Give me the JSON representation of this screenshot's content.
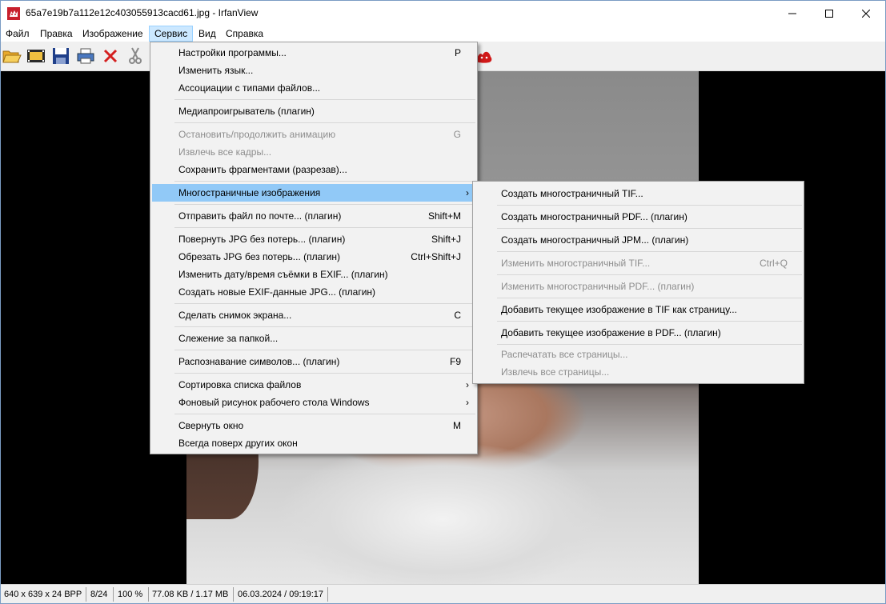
{
  "window": {
    "title": "65a7e19b7a112e12c403055913cacd61.jpg - IrfanView",
    "icon": "irfanview-cat-icon"
  },
  "menubar": [
    {
      "label": "Файл"
    },
    {
      "label": "Правка"
    },
    {
      "label": "Изображение"
    },
    {
      "label": "Сервис",
      "active": true
    },
    {
      "label": "Вид"
    },
    {
      "label": "Справка"
    }
  ],
  "toolbar": [
    "open-folder-icon",
    "slideshow-icon",
    "save-icon",
    "print-icon",
    "delete-icon",
    "cut-icon",
    "irfanview-logo-icon"
  ],
  "service_menu": {
    "items": [
      {
        "label": "Настройки программы...",
        "shortcut": "P"
      },
      {
        "label": "Изменить язык..."
      },
      {
        "label": "Ассоциации с типами файлов..."
      },
      {
        "label": "Медиапроигрыватель (плагин)"
      },
      {
        "label": "Остановить/продолжить анимацию",
        "shortcut": "G",
        "disabled": true
      },
      {
        "label": "Извлечь все кадры...",
        "disabled": true
      },
      {
        "label": "Сохранить фрагментами (разрезав)..."
      },
      {
        "label": "Многостраничные изображения",
        "submenu": true,
        "highlighted": true
      },
      {
        "label": "Отправить файл по почте... (плагин)",
        "shortcut": "Shift+M"
      },
      {
        "label": "Повернуть JPG без потерь... (плагин)",
        "shortcut": "Shift+J"
      },
      {
        "label": "Обрезать JPG без потерь... (плагин)",
        "shortcut": "Ctrl+Shift+J"
      },
      {
        "label": "Изменить дату/время съёмки в EXIF... (плагин)"
      },
      {
        "label": "Создать новые EXIF-данные JPG... (плагин)"
      },
      {
        "label": "Сделать снимок экрана...",
        "shortcut": "C"
      },
      {
        "label": "Слежение за папкой..."
      },
      {
        "label": "Распознавание символов... (плагин)",
        "shortcut": "F9"
      },
      {
        "label": "Сортировка списка файлов",
        "submenu": true
      },
      {
        "label": "Фоновый рисунок рабочего стола Windows",
        "submenu": true
      },
      {
        "label": "Свернуть окно",
        "shortcut": "M"
      },
      {
        "label": "Всегда поверх других окон"
      }
    ]
  },
  "multipage_submenu": {
    "items": [
      {
        "label": "Создать многостраничный TIF..."
      },
      {
        "label": "Создать многостраничный PDF... (плагин)"
      },
      {
        "label": "Создать многостраничный JPM... (плагин)"
      },
      {
        "label": "Изменить многостраничный TIF...",
        "shortcut": "Ctrl+Q",
        "disabled": true
      },
      {
        "label": "Изменить многостраничный PDF... (плагин)",
        "disabled": true
      },
      {
        "label": "Добавить текущее изображение в TIF как страницу..."
      },
      {
        "label": "Добавить текущее изображение в PDF... (плагин)"
      },
      {
        "label": "Распечатать все страницы...",
        "disabled": true
      },
      {
        "label": "Извлечь все страницы...",
        "disabled": true
      }
    ]
  },
  "statusbar": {
    "dimensions": "640 x 639 x 24 BPP",
    "index": "8/24",
    "zoom": "100 %",
    "size": "77.08 KB / 1.17 MB",
    "datetime": "06.03.2024 / 09:19:17"
  }
}
